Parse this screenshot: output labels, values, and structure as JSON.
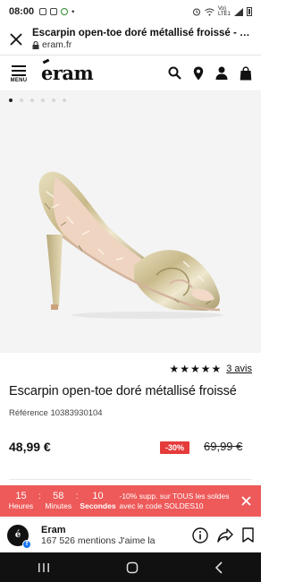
{
  "status_bar": {
    "time": "08:00",
    "network": "Vo) LTE1"
  },
  "browser": {
    "tab_title": "Escarpin open-toe doré métallisé froissé - Esc...",
    "domain": "eram.fr"
  },
  "header": {
    "menu_label": "MENU",
    "logo_text": "eram"
  },
  "gallery": {
    "dot_count": 6,
    "active_dot": 0
  },
  "product": {
    "rating_stars": 5,
    "reviews_link": "3 avis",
    "title": "Escarpin open-toe doré métallisé froissé",
    "reference": "Référence 10383930104",
    "price": "48,99 €",
    "discount": "-30%",
    "old_price": "69,99 €"
  },
  "promo": {
    "hours": "15",
    "hours_label": "Heures",
    "minutes": "58",
    "minutes_label": "Minutes",
    "seconds": "10",
    "seconds_label": "Secondes",
    "text": "-10% supp. sur TOUS les soldes avec le code SOLDES10"
  },
  "facebook": {
    "page_name": "Eram",
    "likes": "167 526 mentions J'aime la"
  },
  "colors": {
    "promo_bg": "#ee5a5a",
    "discount_bg": "#e53b3b",
    "nav_bg": "#111111"
  }
}
